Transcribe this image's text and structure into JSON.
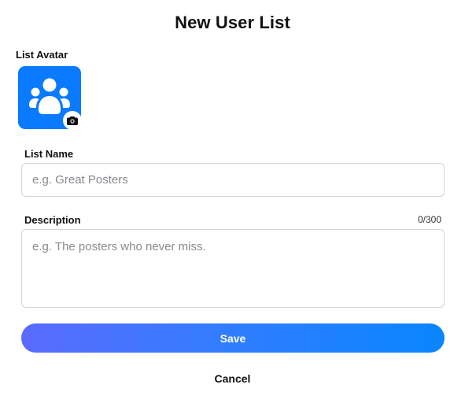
{
  "dialog": {
    "title": "New User List"
  },
  "avatar": {
    "label": "List Avatar",
    "icon": "people-group-icon",
    "overlay_icon": "camera-icon",
    "background_color": "#0a7aff"
  },
  "list_name": {
    "label": "List Name",
    "value": "",
    "placeholder": "e.g. Great Posters"
  },
  "description": {
    "label": "Description",
    "value": "",
    "placeholder": "e.g. The posters who never miss.",
    "counter": "0/300"
  },
  "actions": {
    "save_label": "Save",
    "cancel_label": "Cancel"
  }
}
